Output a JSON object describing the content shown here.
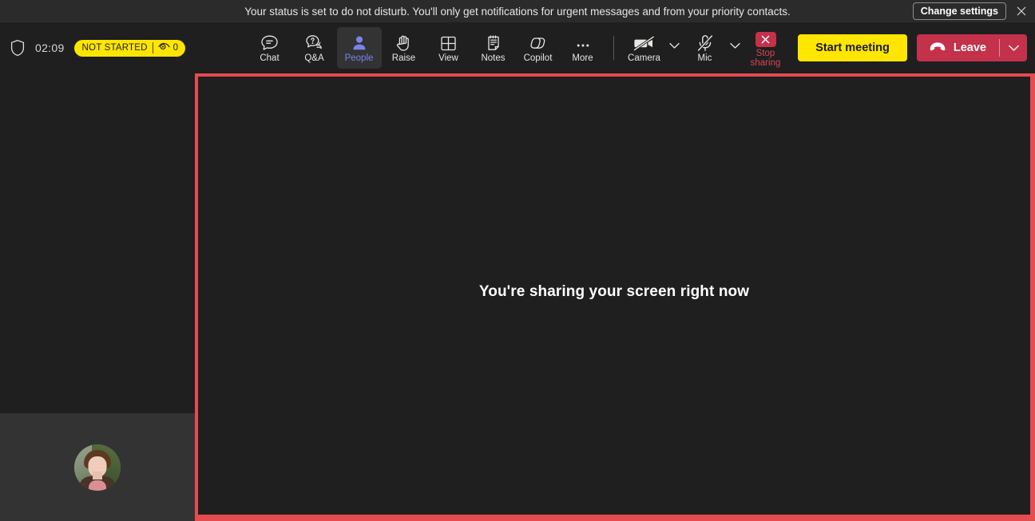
{
  "notification": {
    "message": "Your status is set to do not disturb. You'll only get notifications for urgent messages and from your priority contacts.",
    "change_settings_label": "Change settings",
    "close_icon": "close-icon"
  },
  "toolbar": {
    "shield_icon": "shield-icon",
    "timer": "02:09",
    "status_badge": {
      "label": "NOT STARTED",
      "eye_icon": "eye-icon",
      "viewer_count": "0"
    },
    "items": [
      {
        "label": "Chat",
        "icon": "chat-icon",
        "active": false
      },
      {
        "label": "Q&A",
        "icon": "qna-icon",
        "active": false
      },
      {
        "label": "People",
        "icon": "people-icon",
        "active": true
      },
      {
        "label": "Raise",
        "icon": "raise-hand-icon",
        "active": false
      },
      {
        "label": "View",
        "icon": "grid-view-icon",
        "active": false
      },
      {
        "label": "Notes",
        "icon": "notes-icon",
        "active": false
      },
      {
        "label": "Copilot",
        "icon": "copilot-icon",
        "active": false
      },
      {
        "label": "More",
        "icon": "more-ellipsis-icon",
        "active": false
      }
    ],
    "camera": {
      "label": "Camera",
      "icon": "camera-off-icon",
      "chevron": "chevron-down-icon"
    },
    "mic": {
      "label": "Mic",
      "icon": "mic-off-icon",
      "chevron": "chevron-down-icon"
    },
    "stop_sharing": {
      "label": "Stop sharing",
      "icon": "stop-sharing-x-icon"
    },
    "start_meeting_label": "Start meeting",
    "leave": {
      "label": "Leave",
      "icon": "hangup-icon",
      "chevron": "chevron-down-icon"
    }
  },
  "stage": {
    "sharing_message": "You're sharing your screen right now",
    "self_tile_avatar": "avatar"
  },
  "colors": {
    "accent_yellow": "#ffe600",
    "danger_red": "#c4314b",
    "share_border_red": "#e64b50",
    "active_purple": "#7b83eb",
    "app_background": "#1f1f1f",
    "panel_background": "#333333"
  }
}
